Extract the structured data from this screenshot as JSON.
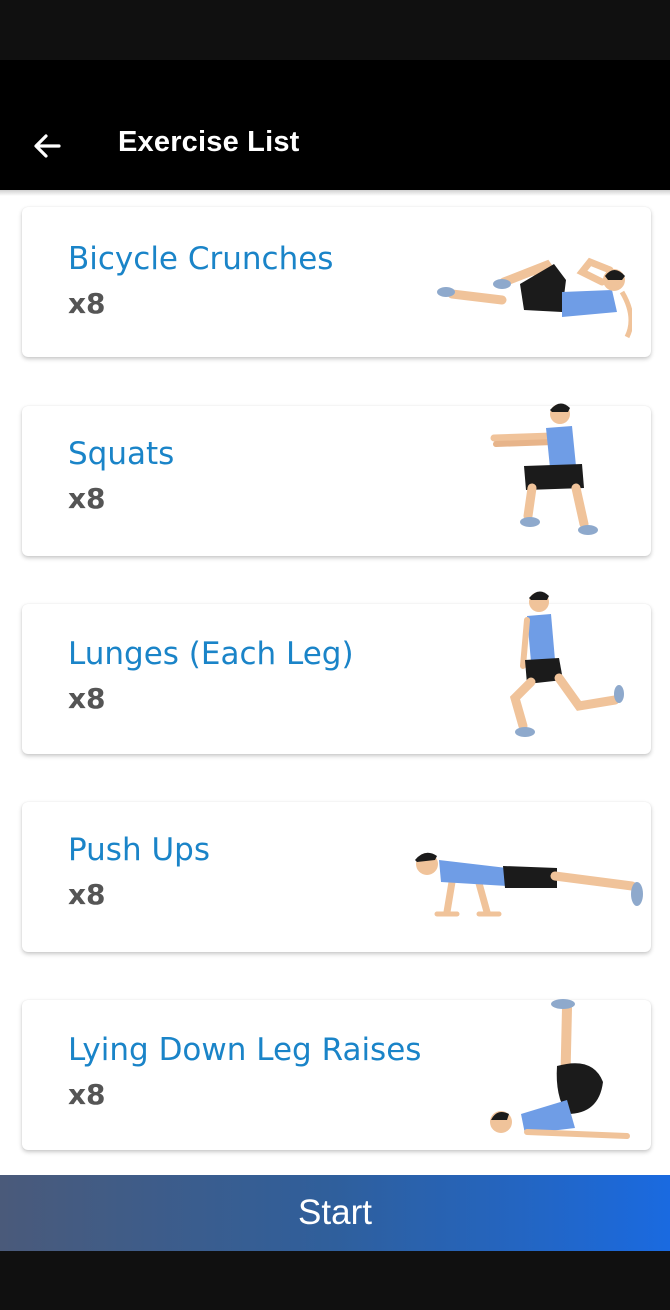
{
  "app_bar": {
    "title": "Exercise List",
    "back_icon": "arrow-left-icon"
  },
  "colors": {
    "accent": "#1a84c8",
    "reps": "#555555",
    "shirt": "#6f9de6",
    "shorts": "#1b1b1b",
    "skin": "#f0c39a"
  },
  "exercises": [
    {
      "name": "Bicycle Crunches",
      "reps": "x8",
      "illustration": "bicycle-crunches-illustration"
    },
    {
      "name": "Squats",
      "reps": "x8",
      "illustration": "squats-illustration"
    },
    {
      "name": "Lunges (Each Leg)",
      "reps": "x8",
      "illustration": "lunges-illustration"
    },
    {
      "name": "Push Ups",
      "reps": "x8",
      "illustration": "push-ups-illustration"
    },
    {
      "name": "Lying Down Leg Raises",
      "reps": "x8",
      "illustration": "leg-raises-illustration"
    }
  ],
  "start_button": {
    "label": "Start"
  }
}
